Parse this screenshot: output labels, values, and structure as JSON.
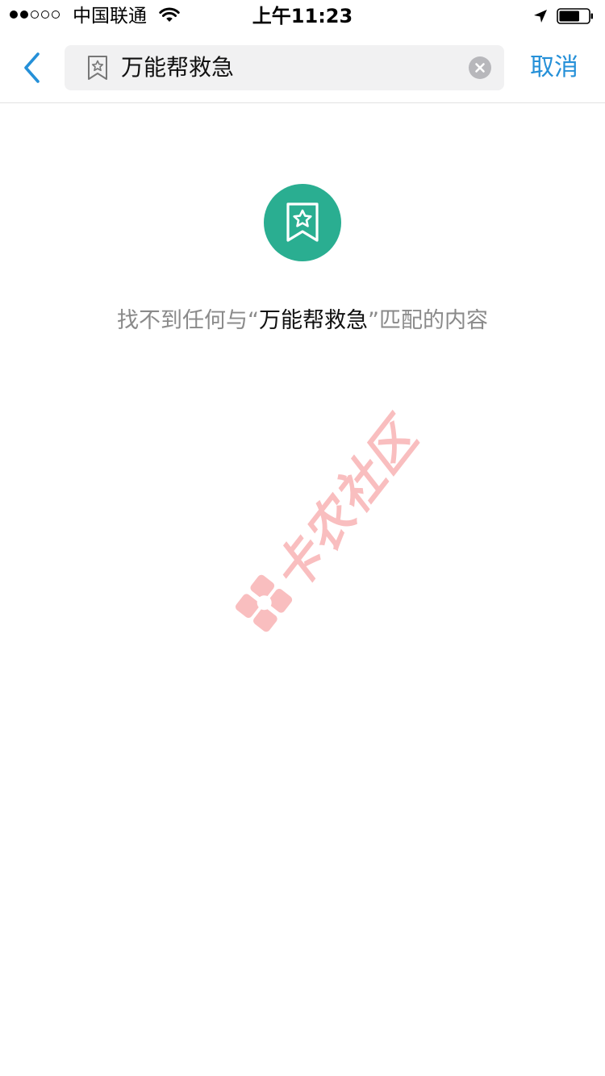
{
  "status_bar": {
    "carrier": "中国联通",
    "time": "上午11:23",
    "signal_filled": 2,
    "signal_total": 5,
    "battery_level": 0.7,
    "icons": [
      "wifi-icon",
      "location-arrow-icon",
      "battery-icon"
    ]
  },
  "nav": {
    "back_icon": "chevron-left-icon",
    "search": {
      "value": "万能帮救急",
      "leading_icon": "bookmark-star-icon",
      "clear_icon": "clear-x-icon"
    },
    "cancel_label": "取消"
  },
  "empty_state": {
    "icon": "bookmark-star-icon",
    "prefix": "找不到任何与“",
    "keyword": "万能帮救急",
    "suffix": "”匹配的内容"
  },
  "watermark": {
    "text": "卡农社区",
    "logo_icon": "kanong-logo-icon"
  },
  "colors": {
    "accent_blue": "#2590d8",
    "empty_icon_green": "#2aae91",
    "muted_text": "#8a8a8a",
    "search_bg": "#f1f1f2",
    "watermark_pink": "#f5898b"
  }
}
